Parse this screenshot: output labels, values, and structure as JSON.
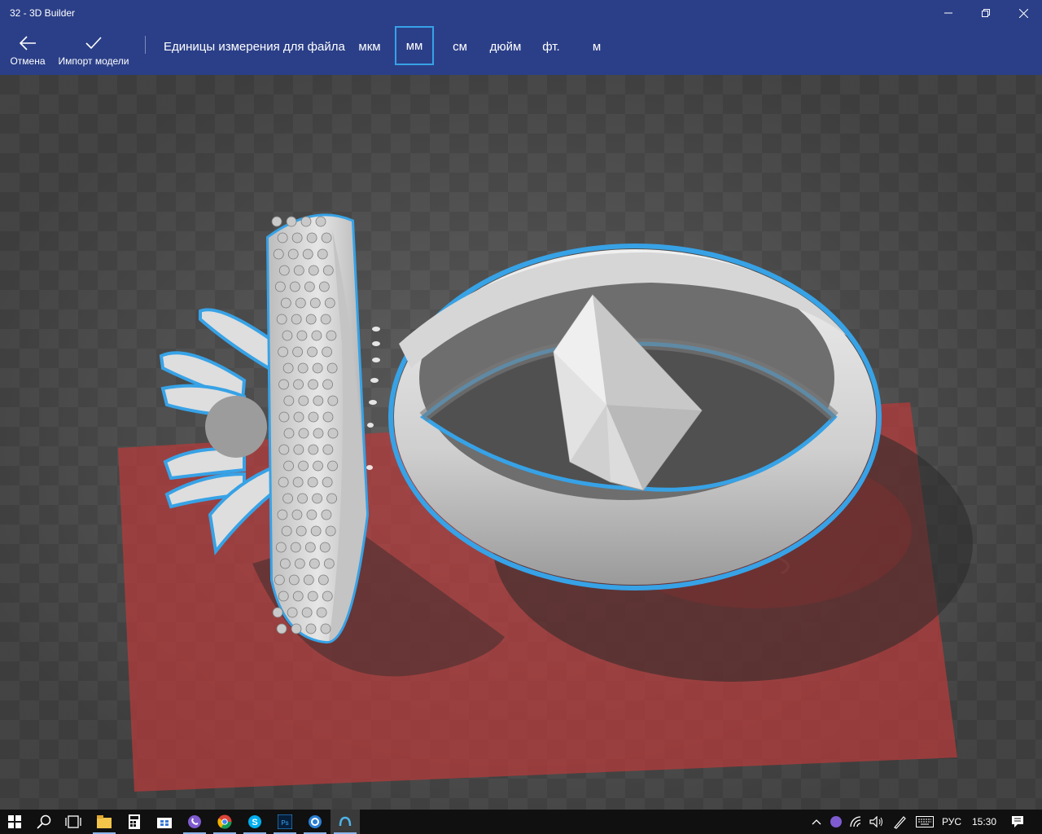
{
  "window": {
    "title": "32 - 3D Builder"
  },
  "toolbar": {
    "cancel_label": "Отмена",
    "import_label": "Импорт модели",
    "units_label": "Единицы измерения для файла",
    "units": [
      {
        "label": "мкм",
        "selected": false
      },
      {
        "label": "мм",
        "selected": true
      },
      {
        "label": "см",
        "selected": false
      },
      {
        "label": "дюйм",
        "selected": false
      },
      {
        "label": "фт.",
        "selected": false
      },
      {
        "label": "м",
        "selected": false
      }
    ]
  },
  "colors": {
    "accent": "#2b3f88",
    "selection": "#37a2e6",
    "build_plate": "#b83a3a",
    "model": "#d9d9d9"
  },
  "taskbar": {
    "apps": [
      "windows-start-icon",
      "search-icon",
      "task-view-icon",
      "file-explorer-icon",
      "calculator-icon",
      "store-icon",
      "viber-icon",
      "chrome-icon",
      "skype-icon",
      "photoshop-icon",
      "app-icon",
      "3d-builder-icon"
    ],
    "language": "РУС",
    "time": "15:30"
  }
}
